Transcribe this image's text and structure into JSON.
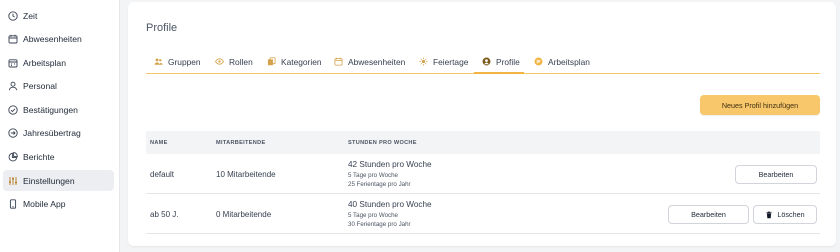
{
  "sidebar": {
    "items": [
      {
        "label": "Zeit",
        "icon": "clock-icon"
      },
      {
        "label": "Abwesenheiten",
        "icon": "calendar-icon"
      },
      {
        "label": "Arbeitsplan",
        "icon": "calendar-grid-icon"
      },
      {
        "label": "Personal",
        "icon": "user-icon"
      },
      {
        "label": "Bestätigungen",
        "icon": "check-circle-icon"
      },
      {
        "label": "Jahresübertrag",
        "icon": "arrow-circle-icon"
      },
      {
        "label": "Berichte",
        "icon": "pie-chart-icon"
      },
      {
        "label": "Einstellungen",
        "icon": "sliders-icon"
      },
      {
        "label": "Mobile App",
        "icon": "mobile-icon"
      }
    ],
    "active_index": 7
  },
  "page": {
    "title": "Profile"
  },
  "tabs": [
    {
      "label": "Gruppen",
      "icon": "users-icon"
    },
    {
      "label": "Rollen",
      "icon": "eye-icon"
    },
    {
      "label": "Kategorien",
      "icon": "copy-icon"
    },
    {
      "label": "Abwesenheiten",
      "icon": "calendar-icon"
    },
    {
      "label": "Feiertage",
      "icon": "sun-icon"
    },
    {
      "label": "Profile",
      "icon": "user-circle-icon"
    },
    {
      "label": "Arbeitsplan",
      "icon": "plan-icon"
    }
  ],
  "active_tab": "Profile",
  "actions": {
    "new_profile": "Neues Profil hinzufügen"
  },
  "table": {
    "headers": [
      "NAME",
      "MITARBEITENDE",
      "STUNDEN PRO WOCHE"
    ],
    "rows": [
      {
        "name": "default",
        "employees": "10 Mitarbeitende",
        "hours": "42 Stunden pro Woche",
        "days": "5 Tage pro Woche",
        "holidays": "25 Ferientage pro Jahr",
        "edit": "Bearbeiten"
      },
      {
        "name": "ab 50 J.",
        "employees": "0 Mitarbeitende",
        "hours": "40 Stunden pro Woche",
        "days": "5 Tage pro Woche",
        "holidays": "30 Ferientage pro Jahr",
        "edit": "Bearbeiten",
        "delete": "Löschen"
      }
    ]
  },
  "colors": {
    "accent": "#f9c76b",
    "tab_underline": "#f2b544",
    "sidebar_active": "#eceef1"
  }
}
